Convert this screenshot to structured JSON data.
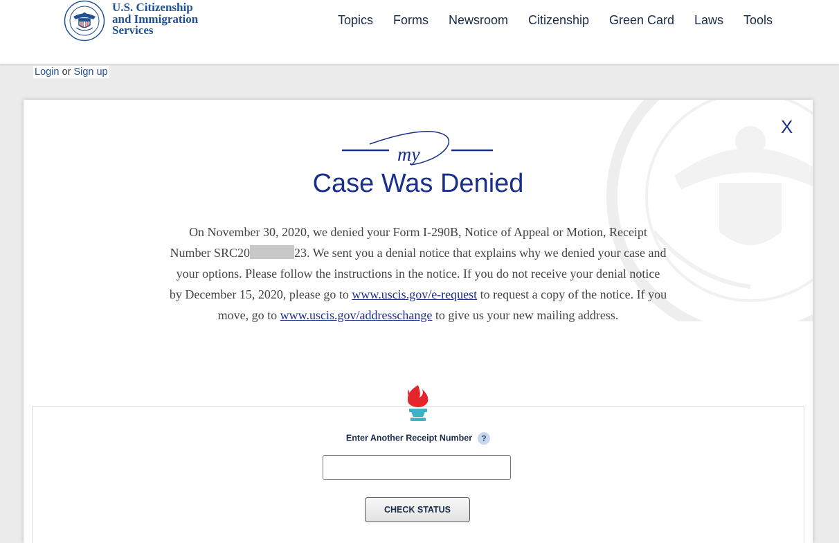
{
  "header": {
    "agency_name": [
      "U.S. Citizenship",
      "and Immigration",
      "Services"
    ],
    "seal_icon": "dhs-seal-icon",
    "nav": [
      "Topics",
      "Forms",
      "Newsroom",
      "Citizenship",
      "Green Card",
      "Laws",
      "Tools"
    ]
  },
  "auth": {
    "login": "Login",
    "separator": " or ",
    "signup": "Sign up"
  },
  "modal": {
    "close_label": "X",
    "logo_text": "my",
    "title": "Case Was Denied",
    "body": {
      "p1": "On November 30, 2020, we denied your Form I-290B, Notice of Appeal or Motion, Receipt Number SRC20",
      "p2": "23. We sent you a denial notice that explains why we denied your case and your options. Please follow the instructions in the notice. If you do not receive your denial notice by December 15, 2020, please go to ",
      "link1": "www.uscis.gov/e-request",
      "p3": " to request a copy of the notice. If you move, go to ",
      "link2": "www.uscis.gov/addresschange",
      "p4": " to give us your new mailing address."
    }
  },
  "receipt": {
    "label": "Enter Another Receipt Number",
    "help": "?",
    "input_value": "",
    "button": "CHECK STATUS"
  },
  "colors": {
    "brand_navy": "#1a2f8a",
    "header_blue": "#1f5092",
    "torch_red": "#e4262b",
    "torch_teal": "#3fb3c5"
  }
}
